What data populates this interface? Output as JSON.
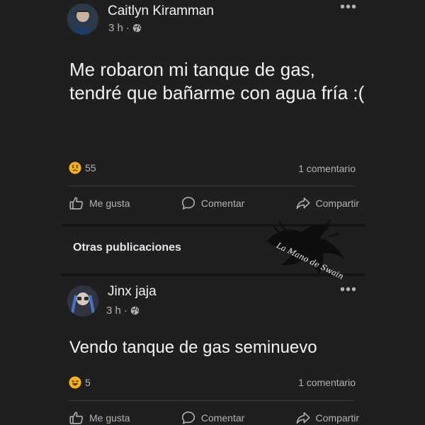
{
  "posts": [
    {
      "author": "Caitlyn Kiramman",
      "time": "3 h",
      "separator": "·",
      "text": "Me robaron mi tanque de gas, tendré que bañarme con agua fría :(",
      "reaction_icon": "sad-emoji-icon",
      "reaction_count": "55",
      "comments": "1 comentario",
      "actions": {
        "like": "Me gusta",
        "comment": "Comentar",
        "share": "Compartir"
      }
    },
    {
      "author": "Jinx jaja",
      "time": "3 h",
      "separator": "·",
      "text": "Vendo tanque de gas seminuevo",
      "reaction_icon": "laugh-emoji-icon",
      "reaction_count": "5",
      "comments": "1 comentario",
      "actions": {
        "like": "Me gusta",
        "comment": "Comentar",
        "share": "Compartir"
      }
    }
  ],
  "section": {
    "title": "Otras publicaciones"
  },
  "watermark": {
    "text": "La Mano de Swain"
  },
  "colors": {
    "background": "#1f1f20",
    "text": "#e4e6eb",
    "secondary_text": "#b0b3b8",
    "sad_emoji": "#f7b125",
    "laugh_emoji": "#f7b125"
  }
}
